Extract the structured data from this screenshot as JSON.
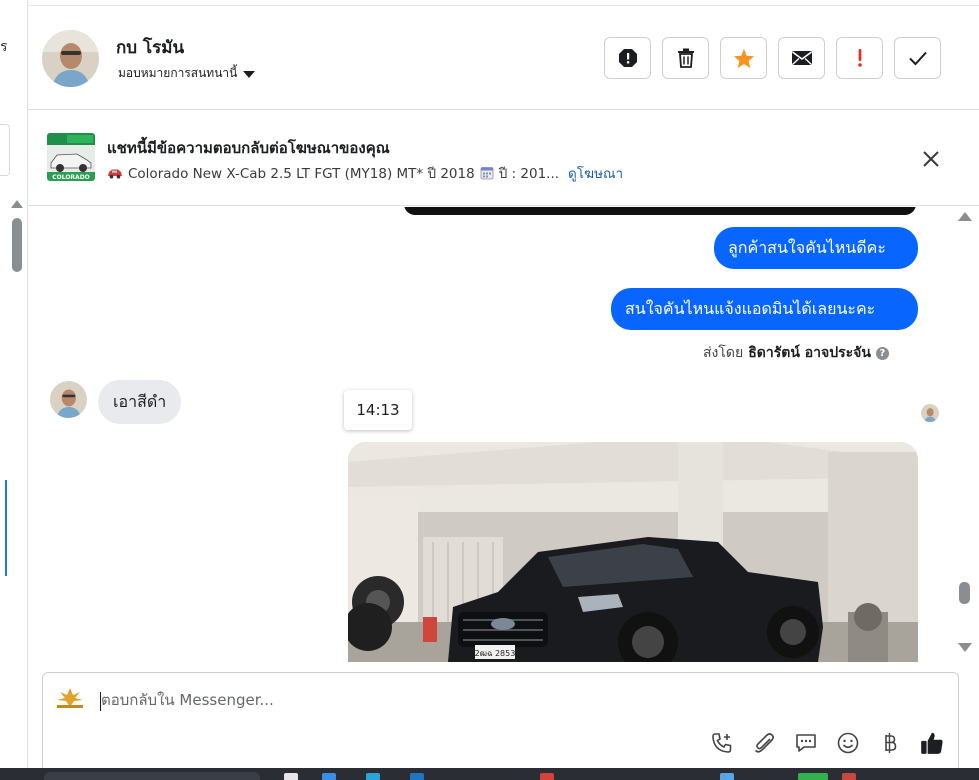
{
  "left_strip": {
    "cut_text": "ร"
  },
  "header": {
    "contact_name": "กบ โรมัน",
    "assign_label": "มอบหมายการสนทนานี้"
  },
  "actions": [
    {
      "name": "spam-icon"
    },
    {
      "name": "trash-icon"
    },
    {
      "name": "star-icon"
    },
    {
      "name": "mark-unread-icon"
    },
    {
      "name": "important-icon"
    },
    {
      "name": "done-check-icon"
    }
  ],
  "ad": {
    "title": "แชทนี้มีข้อความตอบกลับต่อโฆษณาของคุณ",
    "car_text": "Colorado New X-Cab 2.5 LT FGT (MY18) MT* ปี 2018",
    "year_text": "ปี : 201...",
    "link_text": "ดูโฆษณา",
    "thumb_label": "COLORADO"
  },
  "messages": {
    "out_1": "ลูกค้าสนใจคันไหนดีคะ",
    "out_2": "สนใจคันไหนแจ้งแอดมินได้เลยนะคะ",
    "sent_by_prefix": "ส่งโดย",
    "sent_by_name": "ธิดารัตน์ อาจประจัน",
    "in_1": "เอาสีดำ",
    "timestamp": "14:13",
    "plate_text": "2ฒฉ 2853"
  },
  "composer": {
    "placeholder": "ตอบกลับใน Messenger..."
  },
  "colors": {
    "accent": "#0866ff",
    "star": "#f7931e",
    "important": "#e4322b",
    "link": "#1d5fa8"
  }
}
